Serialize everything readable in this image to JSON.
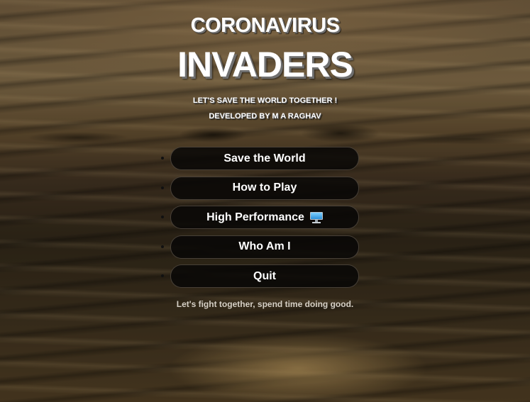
{
  "header": {
    "title_line1": "CORONAVIRUS",
    "title_line2": "INVADERS",
    "tagline": "LET'S SAVE THE WORLD TOGETHER !",
    "developer": "DEVELOPED BY M A RAGHAV"
  },
  "menu": {
    "items": [
      {
        "label": "Save the World"
      },
      {
        "label": "How to Play"
      },
      {
        "label": "High Performance",
        "icon": "desktop-monitor-icon"
      },
      {
        "label": "Who Am I"
      },
      {
        "label": "Quit"
      }
    ]
  },
  "footer": {
    "text": "Let's fight together, spend time doing good."
  },
  "colors": {
    "button_bg": "#0a0908",
    "title_text": "#ffffff",
    "title_shadow": "#6f6f6f",
    "footer_text": "#d6d0c6"
  }
}
